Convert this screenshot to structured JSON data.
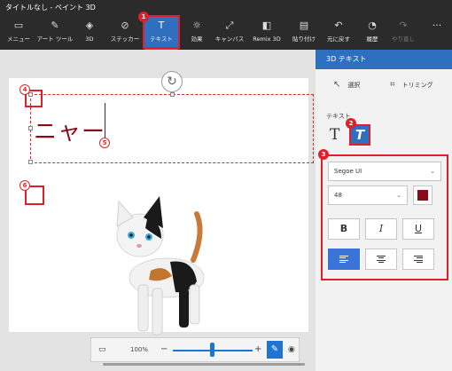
{
  "window": {
    "title": "タイトルなし - ペイント 3D"
  },
  "ribbon": {
    "items": [
      {
        "label": "メニュー",
        "icon": "folder-icon"
      },
      {
        "label": "アート ツール",
        "icon": "brush-icon"
      },
      {
        "label": "3D",
        "icon": "cube-icon"
      },
      {
        "label": "ステッカー",
        "icon": "sticker-icon"
      },
      {
        "label": "テキスト",
        "icon": "text-icon"
      },
      {
        "label": "効果",
        "icon": "sun-icon"
      },
      {
        "label": "キャンバス",
        "icon": "canvas-icon"
      },
      {
        "label": "Remix 3D",
        "icon": "remix-icon"
      },
      {
        "label": "貼り付け",
        "icon": "paste-icon"
      },
      {
        "label": "元に戻す",
        "icon": "undo-icon"
      },
      {
        "label": "履歴",
        "icon": "history-icon"
      },
      {
        "label": "やり直し",
        "icon": "redo-icon"
      }
    ],
    "more": "···"
  },
  "canvas": {
    "text": "ニャー",
    "text_color": "#8b0a1a"
  },
  "badges": {
    "b1": "1",
    "b2": "2",
    "b3": "3",
    "b4": "4",
    "b5": "5",
    "b6": "6"
  },
  "zoom": {
    "value": "100%",
    "plus": "+"
  },
  "panel": {
    "title": "3D テキスト",
    "select_label": "選択",
    "trim_label": "トリミング",
    "text_section": "テキスト",
    "font_name": "Segoe UI",
    "font_size": "48",
    "font_color": "#8b0a1a",
    "bold": "B",
    "italic": "I",
    "underline": "U"
  },
  "colors": {
    "accent": "#2f6fbf",
    "annotation": "#e01f2a",
    "ribbon_bg": "#2b2b2b"
  }
}
